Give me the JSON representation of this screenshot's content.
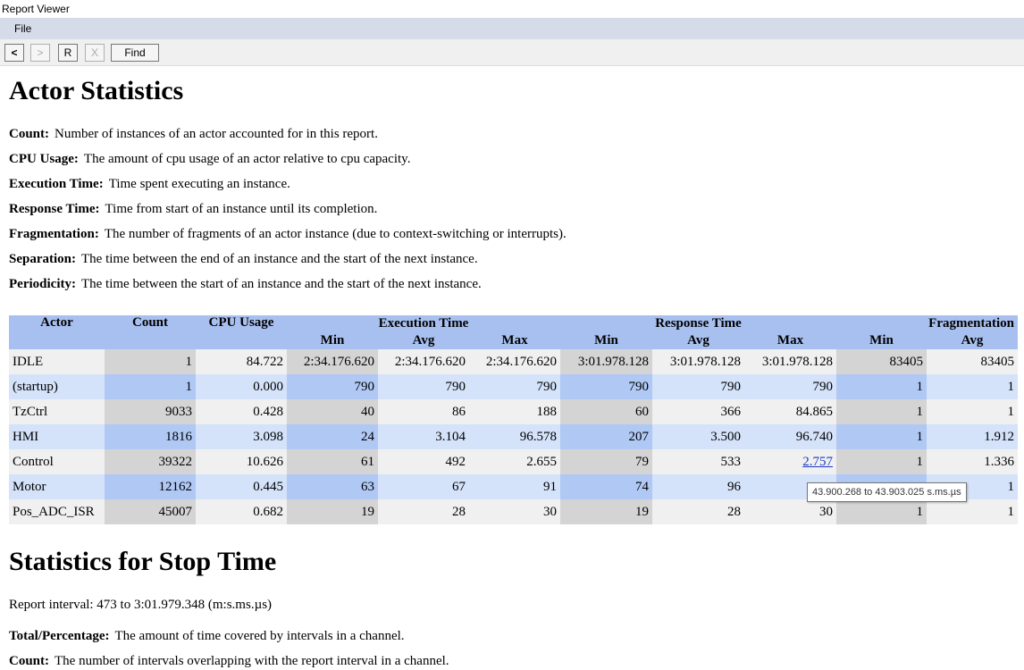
{
  "window": {
    "title": "Report Viewer"
  },
  "menu": {
    "file": "File"
  },
  "toolbar": {
    "back": "<",
    "forward": ">",
    "refresh": "R",
    "close": "X",
    "find": "Find"
  },
  "actor_stats": {
    "title": "Actor Statistics",
    "definitions": [
      {
        "term": "Count:",
        "text": "Number of instances of an actor accounted for in this report."
      },
      {
        "term": "CPU Usage:",
        "text": "The amount of cpu usage of an actor relative to cpu capacity."
      },
      {
        "term": "Execution Time:",
        "text": "Time spent executing an instance."
      },
      {
        "term": "Response Time:",
        "text": "Time from start of an instance until its completion."
      },
      {
        "term": "Fragmentation:",
        "text": "The number of fragments of an actor instance (due to context-switching or interrupts)."
      },
      {
        "term": "Separation:",
        "text": "The time between the end of an instance and the start of the next instance."
      },
      {
        "term": "Periodicity:",
        "text": "The time between the start of an instance and the start of the next instance."
      }
    ],
    "table": {
      "headers": {
        "actor": "Actor",
        "count": "Count",
        "cpu": "CPU Usage",
        "exec": "Execution Time",
        "resp": "Response Time",
        "frag": "Fragmentation"
      },
      "sub": {
        "min": "Min",
        "avg": "Avg",
        "max": "Max"
      },
      "rows": [
        [
          "IDLE",
          "1",
          "84.722",
          "2:34.176.620",
          "2:34.176.620",
          "2:34.176.620",
          "3:01.978.128",
          "3:01.978.128",
          "3:01.978.128",
          "83405",
          "83405"
        ],
        [
          "(startup)",
          "1",
          "0.000",
          "790",
          "790",
          "790",
          "790",
          "790",
          "790",
          "1",
          "1"
        ],
        [
          "TzCtrl",
          "9033",
          "0.428",
          "40",
          "86",
          "188",
          "60",
          "366",
          "84.865",
          "1",
          "1"
        ],
        [
          "HMI",
          "1816",
          "3.098",
          "24",
          "3.104",
          "96.578",
          "207",
          "3.500",
          "96.740",
          "1",
          "1.912"
        ],
        [
          "Control",
          "39322",
          "10.626",
          "61",
          "492",
          "2.655",
          "79",
          "533",
          "2.757",
          "1",
          "1.336"
        ],
        [
          "Motor",
          "12162",
          "0.445",
          "63",
          "67",
          "91",
          "74",
          "96",
          "",
          "",
          "1"
        ],
        [
          "Pos_ADC_ISR",
          "45007",
          "0.682",
          "19",
          "28",
          "30",
          "19",
          "28",
          "30",
          "1",
          "1"
        ]
      ]
    },
    "tooltip": "43.900.268 to 43.903.025 s.ms.µs"
  },
  "stop_time": {
    "title": "Statistics for Stop Time",
    "interval": "Report interval: 473 to 3:01.979.348 (m:s.ms.µs)",
    "definitions": [
      {
        "term": "Total/Percentage:",
        "text": "The amount of time covered by intervals in a channel."
      },
      {
        "term": "Count:",
        "text": "The number of intervals overlapping with the report interval in a channel."
      }
    ]
  }
}
